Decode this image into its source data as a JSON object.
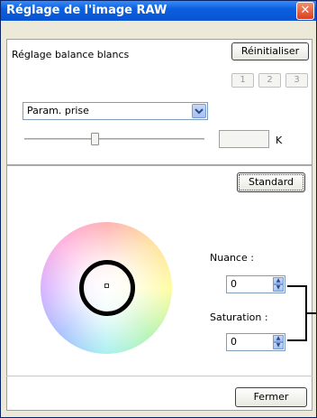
{
  "window": {
    "title": "Réglage de l'image RAW",
    "close_glyph": "✕"
  },
  "white_balance": {
    "label": "Réglage balance blancs",
    "reset_button": "Réinitialiser",
    "presets": [
      "1",
      "2",
      "3"
    ],
    "mode_select": "Param. prise",
    "temperature_value": "",
    "temperature_unit": "K"
  },
  "color": {
    "standard_button": "Standard",
    "nuance_label": "Nuance :",
    "nuance_value": "0",
    "saturation_label": "Saturation :",
    "saturation_value": "0"
  },
  "footer": {
    "close_button": "Fermer"
  },
  "icons": {
    "select_arrow": "chevron-down-icon",
    "spin_up": "spin-up-icon",
    "spin_down": "spin-down-icon"
  }
}
